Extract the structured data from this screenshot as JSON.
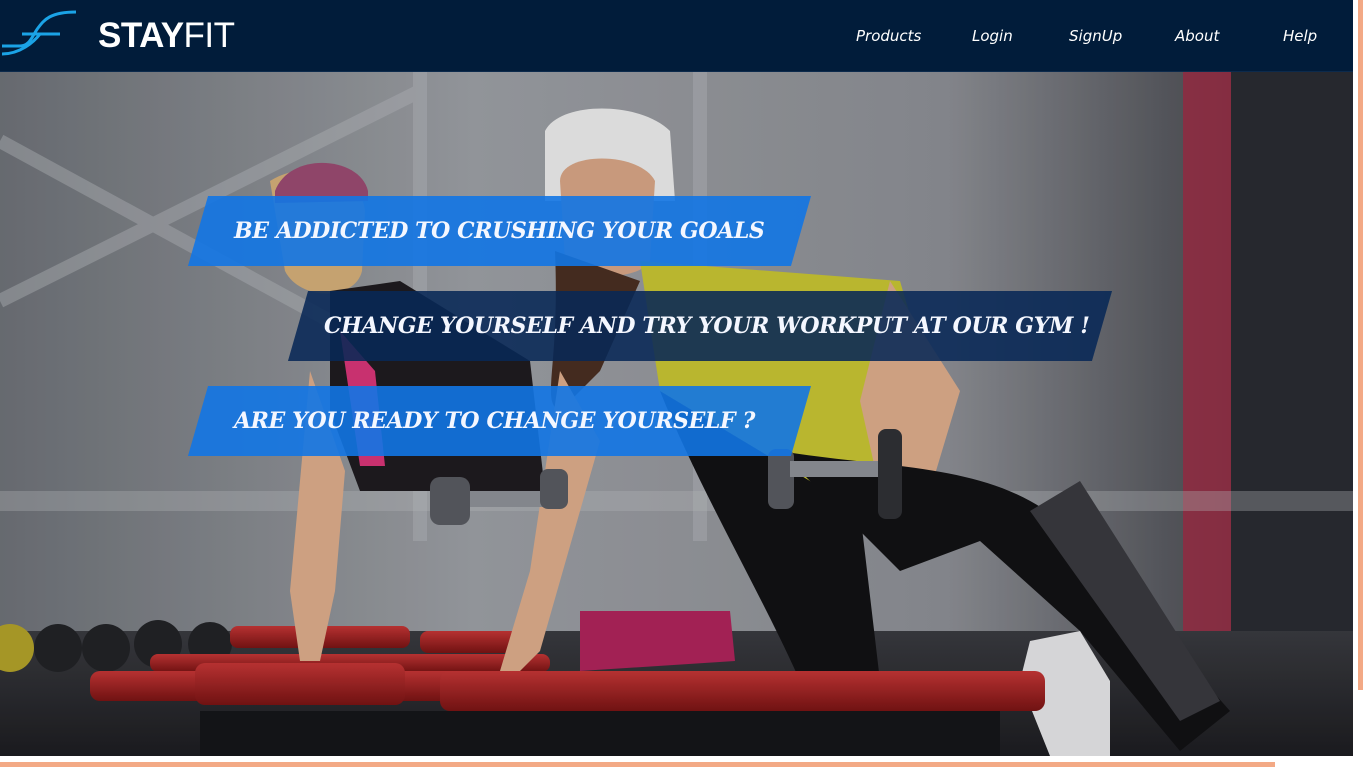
{
  "brand": {
    "name_bold": "STAY",
    "name_light": "FIT",
    "logo_icon": "stayfit-wave-icon",
    "accent_color": "#1ba3e6"
  },
  "nav": {
    "items": [
      {
        "label": "Products"
      },
      {
        "label": "Login"
      },
      {
        "label": "SignUp"
      },
      {
        "label": "About"
      },
      {
        "label": "Help"
      }
    ]
  },
  "hero": {
    "banners": [
      {
        "text": "BE ADDICTED TO CRUSHING YOUR GOALS",
        "color": "#1276e4"
      },
      {
        "text": "CHANGE YOURSELF AND TRY YOUR WORKPUT AT OUR GYM !",
        "color": "#082856"
      },
      {
        "text": "ARE YOU READY TO CHANGE YOURSELF ?",
        "color": "#1276e4"
      }
    ],
    "background_image": "gym-photo-two-women-dumbbell-rows"
  },
  "theme": {
    "navbar_bg": "#011c3a",
    "frame_accent": "#f3a985"
  }
}
